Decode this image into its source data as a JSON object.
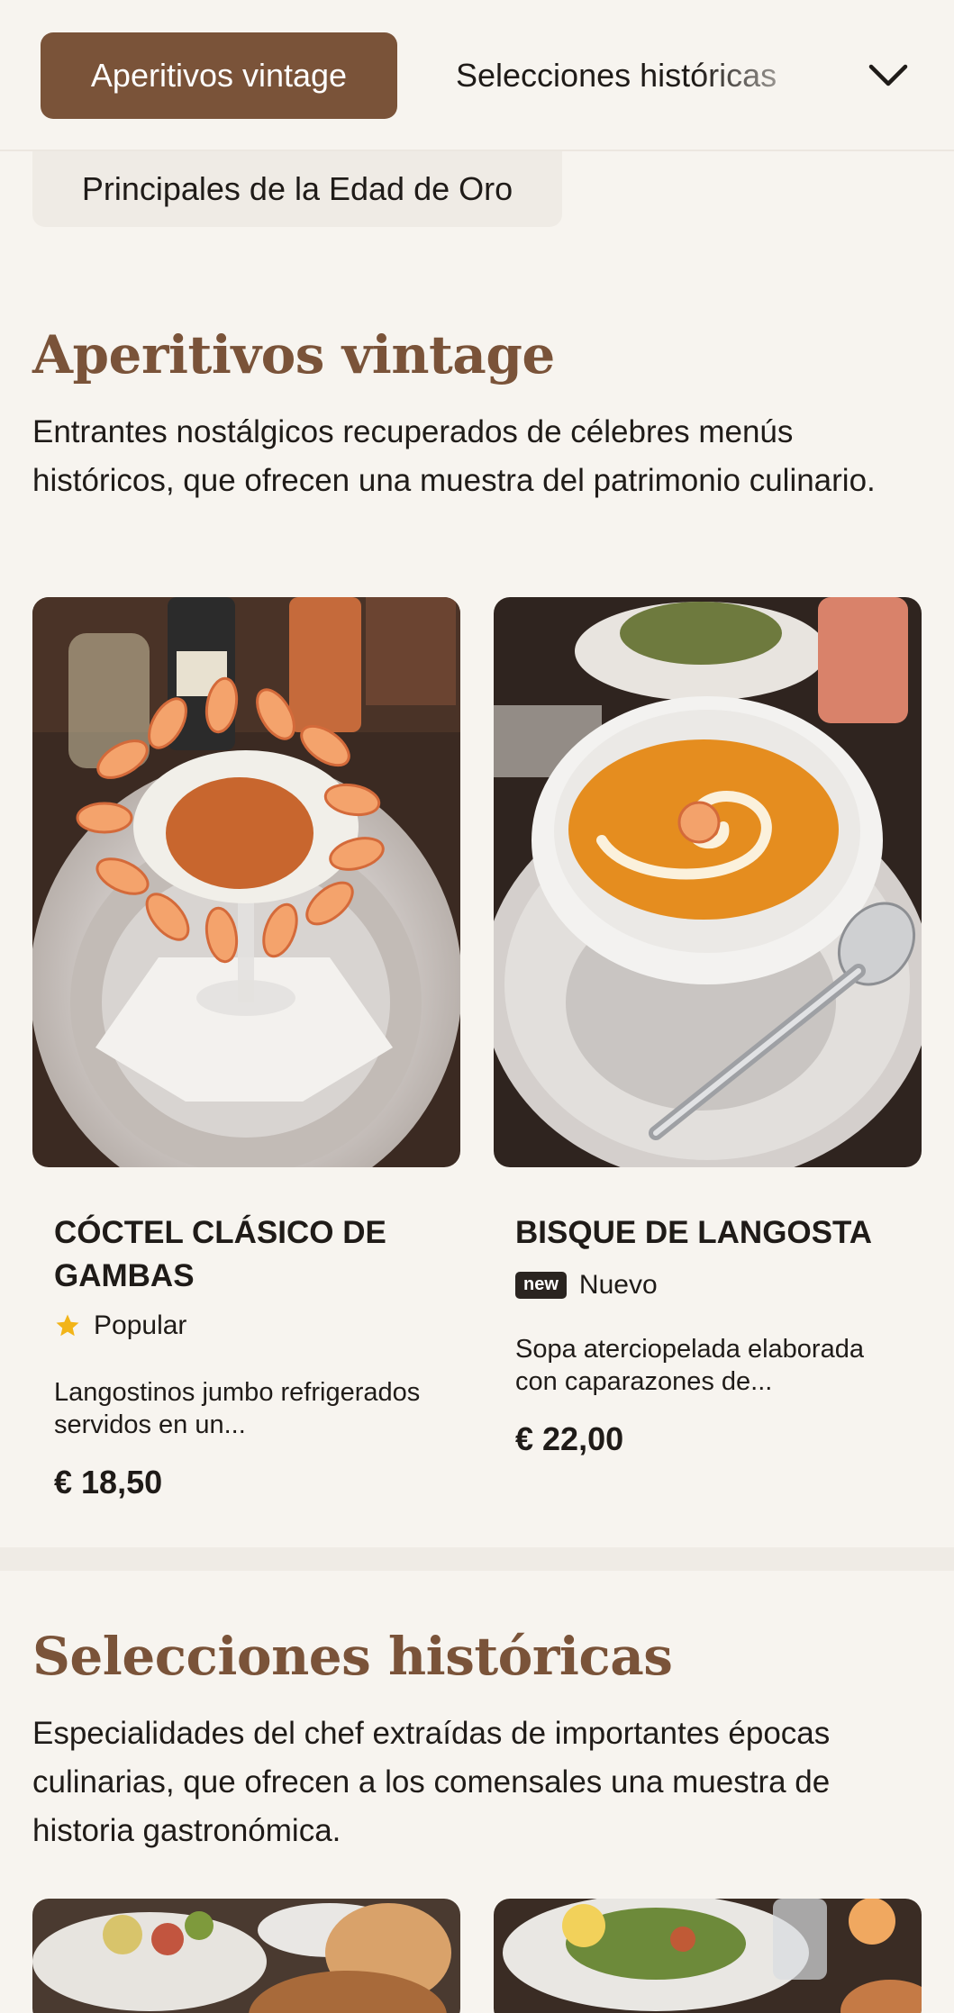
{
  "nav": {
    "active_chip": "Aperitivos vintage",
    "chip_2": "Selecciones históricas",
    "chip_3": "Principales de la Edad de Oro"
  },
  "sections": [
    {
      "title": "Aperitivos vintage",
      "description": "Entrantes nostálgicos recuperados de célebres menús históricos, que ofrecen una muestra del patrimonio culinario.",
      "items": [
        {
          "title": "CÓCTEL CLÁSICO DE GAMBAS",
          "badge_icon": "star-icon",
          "badge_label": "Popular",
          "description": "Langostinos jumbo refrigerados servidos en un...",
          "price": "€ 18,50"
        },
        {
          "title": "BISQUE DE LANGOSTA",
          "badge_tag": "new",
          "badge_label": "Nuevo",
          "description": "Sopa aterciopelada elaborada con caparazones de...",
          "price": "€ 22,00"
        }
      ]
    },
    {
      "title": "Selecciones históricas",
      "description": "Especialidades del chef extraídas de importantes épocas culinarias, que ofrecen a los comensales una muestra de historia gastronómica."
    }
  ],
  "colors": {
    "accent": "#7a5339",
    "background": "#f7f4ef",
    "star": "#f2b418"
  }
}
